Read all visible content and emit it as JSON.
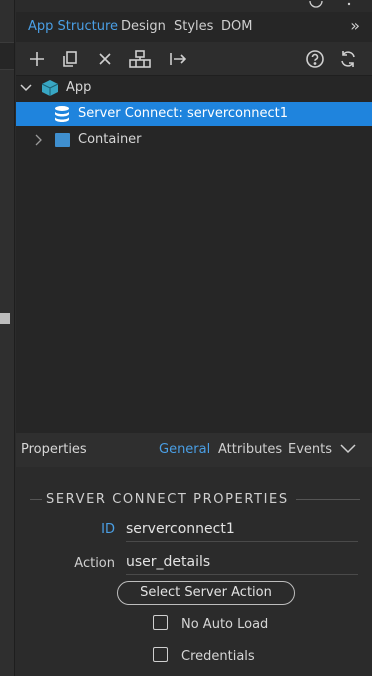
{
  "top_tabs": [
    {
      "label": "App Structure",
      "active": true
    },
    {
      "label": "Design",
      "active": false
    },
    {
      "label": "Styles",
      "active": false
    },
    {
      "label": "DOM",
      "active": false
    }
  ],
  "more_glyph": "»",
  "toolbar_icons": [
    "add-icon",
    "duplicate-icon",
    "delete-icon",
    "wrap-icon",
    "move-out-icon",
    "help-icon",
    "refresh-icon"
  ],
  "tree": {
    "root": {
      "label": "App",
      "icon": "cube-icon"
    },
    "items": [
      {
        "label": "Server Connect: serverconnect1",
        "icon": "database-icon",
        "selected": true
      },
      {
        "label": "Container",
        "icon": "container-icon",
        "selected": false
      }
    ]
  },
  "properties": {
    "title": "Properties",
    "tabs": [
      {
        "label": "General",
        "active": true
      },
      {
        "label": "Attributes",
        "active": false
      },
      {
        "label": "Events",
        "active": false
      }
    ],
    "section_title": "SERVER CONNECT PROPERTIES",
    "fields": {
      "id": {
        "label": "ID",
        "value": "serverconnect1"
      },
      "action": {
        "label": "Action",
        "value": "user_details"
      }
    },
    "select_button": "Select Server Action",
    "checkboxes": [
      {
        "label": "No Auto Load",
        "checked": false
      },
      {
        "label": "Credentials",
        "checked": false
      }
    ]
  },
  "colors": {
    "accent": "#4a9fe5",
    "selection": "#1f84dd",
    "app_icon": "#38a7c4",
    "container_icon": "#3f8fcf"
  }
}
